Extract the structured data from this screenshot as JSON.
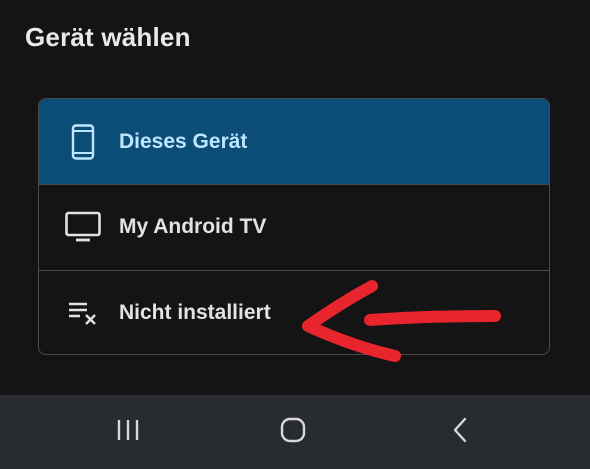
{
  "dialog": {
    "title": "Gerät wählen"
  },
  "devices": [
    {
      "label": "Dieses Gerät",
      "icon": "smartphone-icon",
      "selected": true
    },
    {
      "label": "My Android TV",
      "icon": "tv-icon",
      "selected": false
    },
    {
      "label": "Nicht installiert",
      "icon": "clear-list-icon",
      "selected": false
    }
  ],
  "annotation": {
    "color": "#e8242d",
    "shape": "red-arrow-icon"
  },
  "navbar": {
    "recents": "recents-icon",
    "home": "home-icon",
    "back": "back-icon"
  },
  "colors": {
    "background": "#141414",
    "selected_item": "#0c4d77",
    "selected_text": "#bfe6ff",
    "text": "#e2e2e2",
    "navbar": "#282b30"
  }
}
